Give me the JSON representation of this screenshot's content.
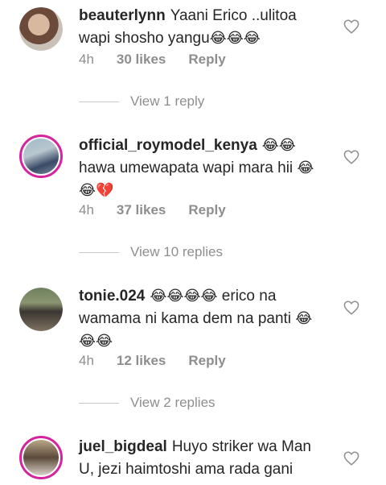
{
  "comments": [
    {
      "username": "beauterlynn",
      "text": "Yaani Erico ..ulitoa wapi shosho yangu",
      "emoji": "😂😂😂",
      "time": "4h",
      "likes": "30 likes",
      "reply": "Reply",
      "view_replies": "View 1 reply"
    },
    {
      "username": "official_roymodel_kenya",
      "text": "hawa umewapata wapi mara hii",
      "username_emoji": "😂😂",
      "emoji": "😂😂💔",
      "time": "4h",
      "likes": "37 likes",
      "reply": "Reply",
      "view_replies": "View 10 replies"
    },
    {
      "username": "tonie.024",
      "username_emoji": "😂😂😂😂",
      "text": "erico na wamama ni kama dem na panti",
      "emoji": "😂😂😂",
      "time": "4h",
      "likes": "12 likes",
      "reply": "Reply",
      "view_replies": "View 2 replies"
    },
    {
      "username": "juel_bigdeal",
      "text": "Huyo striker wa Man U, jezi haimtoshi ama rada gani"
    }
  ],
  "colors": {
    "username": "#262626",
    "meta": "#8e8e8e",
    "ring": "#d6249f"
  }
}
